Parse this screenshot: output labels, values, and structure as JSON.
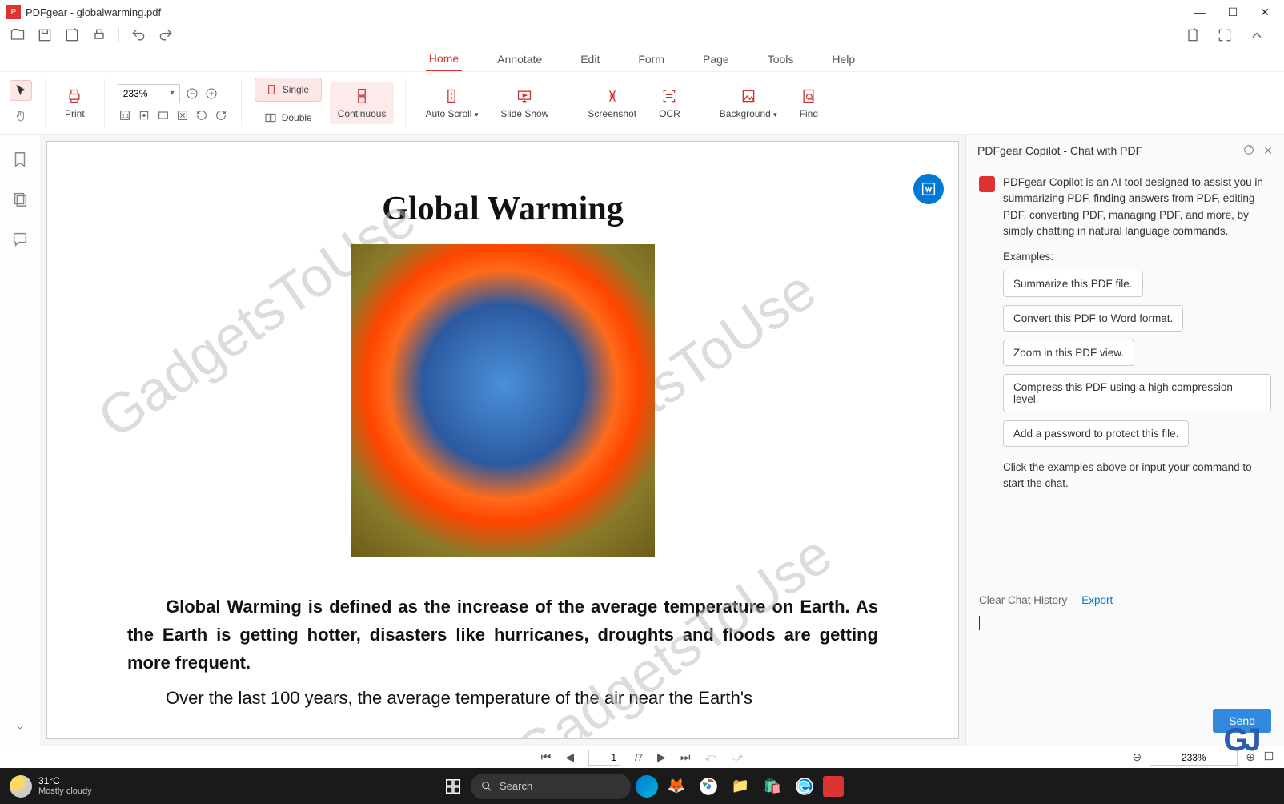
{
  "titlebar": {
    "title": "PDFgear - globalwarming.pdf"
  },
  "tabs": {
    "home": "Home",
    "annotate": "Annotate",
    "edit": "Edit",
    "form": "Form",
    "page": "Page",
    "tools": "Tools",
    "help": "Help"
  },
  "ribbon": {
    "print": "Print",
    "zoom_value": "233%",
    "single": "Single",
    "double": "Double",
    "continuous": "Continuous",
    "auto_scroll": "Auto Scroll",
    "slide_show": "Slide Show",
    "screenshot": "Screenshot",
    "ocr": "OCR",
    "background": "Background",
    "find": "Find"
  },
  "document": {
    "title": "Global Warming",
    "watermark": "GadgetsToUse",
    "para1_bold": "Global Warming is defined as the increase of the average temperature on Earth. As the Earth is getting hotter, disasters like hurricanes, droughts and floods are getting more frequent.",
    "para2": "Over the last 100 years, the average temperature of the air near the Earth's"
  },
  "copilot": {
    "header": "PDFgear Copilot - Chat with PDF",
    "intro": "PDFgear Copilot is an AI tool designed to assist you in summarizing PDF, finding answers from PDF, editing PDF, converting PDF, managing PDF, and more, by simply chatting in natural language commands.",
    "examples_label": "Examples:",
    "ex1": "Summarize this PDF file.",
    "ex2": "Convert this PDF to Word format.",
    "ex3": "Zoom in this PDF view.",
    "ex4": "Compress this PDF using a high compression level.",
    "ex5": "Add a password to protect this file.",
    "hint": "Click the examples above or input your command to start the chat.",
    "clear": "Clear Chat History",
    "export": "Export",
    "send": "Send"
  },
  "bottombar": {
    "page_current": "1",
    "page_total": "/7",
    "zoom": "233%"
  },
  "taskbar": {
    "temp": "31°C",
    "condition": "Mostly cloudy",
    "search_placeholder": "Search"
  }
}
